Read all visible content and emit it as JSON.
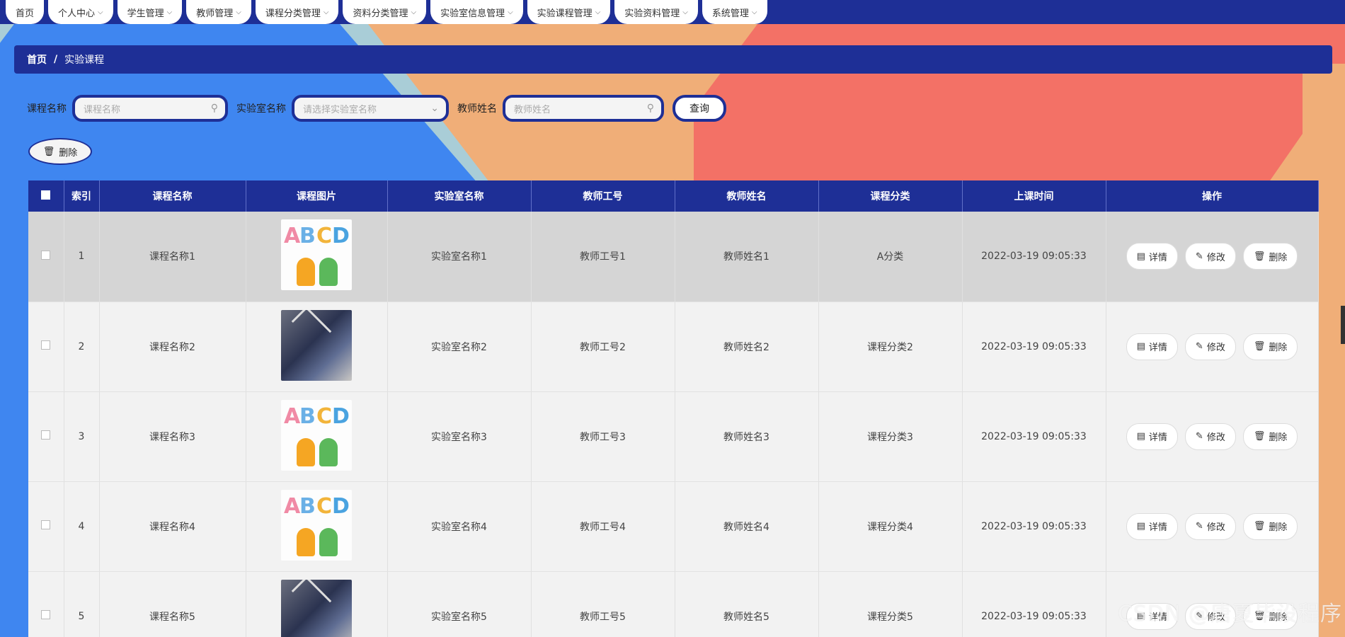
{
  "nav": [
    {
      "label": "首页",
      "chevron": false
    },
    {
      "label": "个人中心",
      "chevron": true
    },
    {
      "label": "学生管理",
      "chevron": true
    },
    {
      "label": "教师管理",
      "chevron": true
    },
    {
      "label": "课程分类管理",
      "chevron": true
    },
    {
      "label": "资料分类管理",
      "chevron": true
    },
    {
      "label": "实验室信息管理",
      "chevron": true
    },
    {
      "label": "实验课程管理",
      "chevron": true
    },
    {
      "label": "实验资料管理",
      "chevron": true
    },
    {
      "label": "系统管理",
      "chevron": true
    }
  ],
  "breadcrumb": {
    "home": "首页",
    "separator": "/",
    "current": "实验课程"
  },
  "search": {
    "course_label": "课程名称",
    "course_placeholder": "课程名称",
    "lab_label": "实验室名称",
    "lab_placeholder": "请选择实验室名称",
    "teacher_label": "教师姓名",
    "teacher_placeholder": "教师姓名",
    "query_label": "查询"
  },
  "toolbar": {
    "delete_label": "删除"
  },
  "table": {
    "headers": [
      "",
      "索引",
      "课程名称",
      "课程图片",
      "实验室名称",
      "教师工号",
      "教师姓名",
      "课程分类",
      "上课时间",
      "操作"
    ],
    "rows": [
      {
        "index": "1",
        "course": "课程名称1",
        "image": "abc",
        "lab": "实验室名称1",
        "teacher_no": "教师工号1",
        "teacher": "教师姓名1",
        "category": "A分类",
        "time": "2022-03-19 09:05:33"
      },
      {
        "index": "2",
        "course": "课程名称2",
        "image": "photo",
        "lab": "实验室名称2",
        "teacher_no": "教师工号2",
        "teacher": "教师姓名2",
        "category": "课程分类2",
        "time": "2022-03-19 09:05:33"
      },
      {
        "index": "3",
        "course": "课程名称3",
        "image": "abc",
        "lab": "实验室名称3",
        "teacher_no": "教师工号3",
        "teacher": "教师姓名3",
        "category": "课程分类3",
        "time": "2022-03-19 09:05:33"
      },
      {
        "index": "4",
        "course": "课程名称4",
        "image": "abc",
        "lab": "实验室名称4",
        "teacher_no": "教师工号4",
        "teacher": "教师姓名4",
        "category": "课程分类4",
        "time": "2022-03-19 09:05:33"
      },
      {
        "index": "5",
        "course": "课程名称5",
        "image": "photo",
        "lab": "实验室名称5",
        "teacher_no": "教师工号5",
        "teacher": "教师姓名5",
        "category": "课程分类5",
        "time": "2022-03-19 09:05:33"
      }
    ],
    "actions": {
      "detail": "详情",
      "edit": "修改",
      "delete": "删除"
    }
  },
  "watermark": "CSDN @唐夏毕设程序",
  "colors": {
    "nav": "#1e2f96",
    "bg_blue": "#3f86f0",
    "bg_peach": "#f0ae78",
    "bg_coral": "#f37166"
  }
}
